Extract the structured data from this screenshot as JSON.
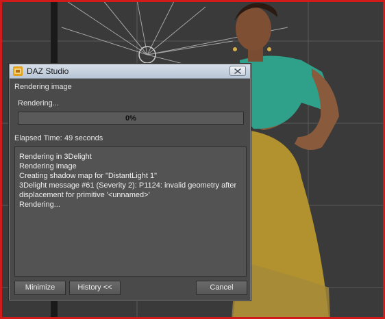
{
  "dialog": {
    "title": "DAZ Studio",
    "status": "Rendering image",
    "progress_label": "Rendering...",
    "progress_value": 0,
    "progress_text": "0%",
    "elapsed_label": "Elapsed Time:",
    "elapsed_value": "49 seconds",
    "log": [
      "Rendering in 3Delight",
      "Rendering image",
      "Creating shadow map for \"DistantLight 1\"",
      "3Delight message #61 (Severity 2): P1124: invalid geometry after",
      "displacement for primitive '<unnamed>'",
      "Rendering..."
    ],
    "buttons": {
      "minimize": "Minimize",
      "history": "History <<",
      "cancel": "Cancel"
    }
  },
  "colors": {
    "viewport_border": "#d11a1a",
    "progress_fill": "#6fa0d0"
  }
}
